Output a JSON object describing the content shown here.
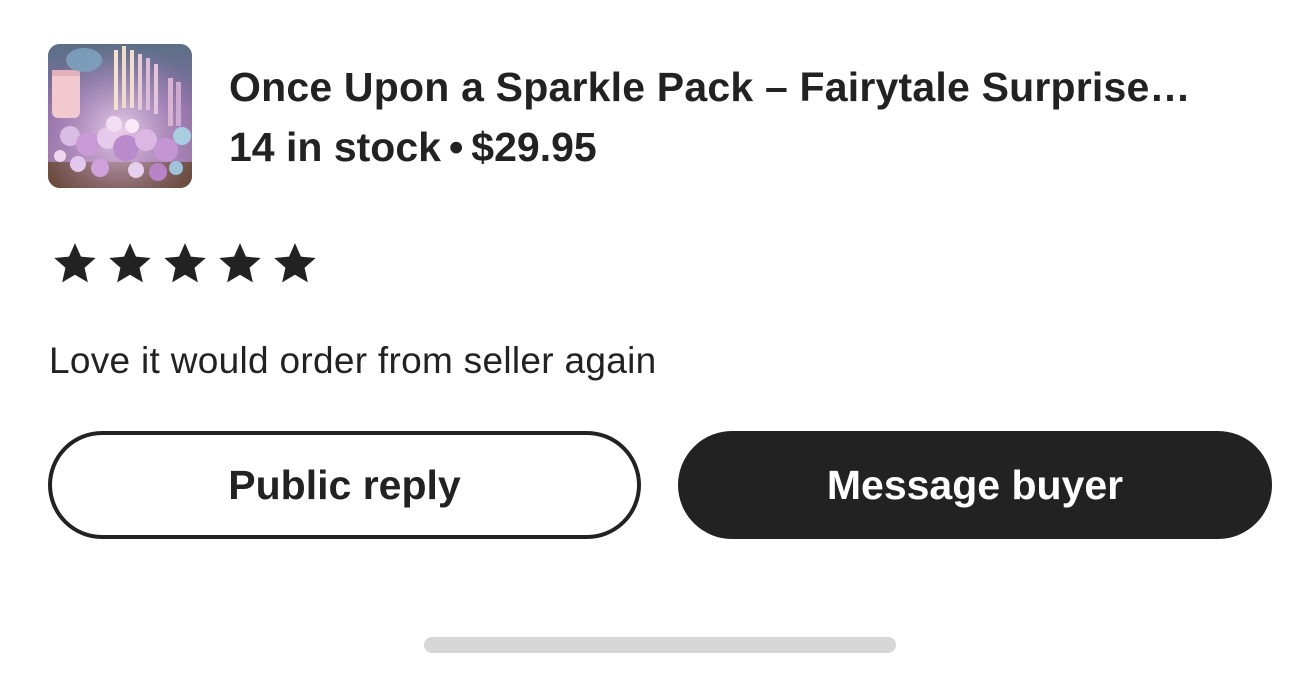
{
  "product": {
    "title": "Once Upon a Sparkle Pack – Fairytale Surprise…",
    "stock": "14 in stock",
    "separator": "•",
    "price": "$29.95",
    "thumbnail_icon": "product-thumbnail-image"
  },
  "review": {
    "rating": 5,
    "rating_max": 5,
    "star_icon": "star-icon",
    "text": "Love it would order from seller again"
  },
  "actions": {
    "public_reply_label": "Public reply",
    "message_buyer_label": "Message buyer"
  },
  "colors": {
    "text": "#222222",
    "primary_button_bg": "#222222",
    "primary_button_text": "#ffffff",
    "home_indicator": "#d6d6d6"
  }
}
